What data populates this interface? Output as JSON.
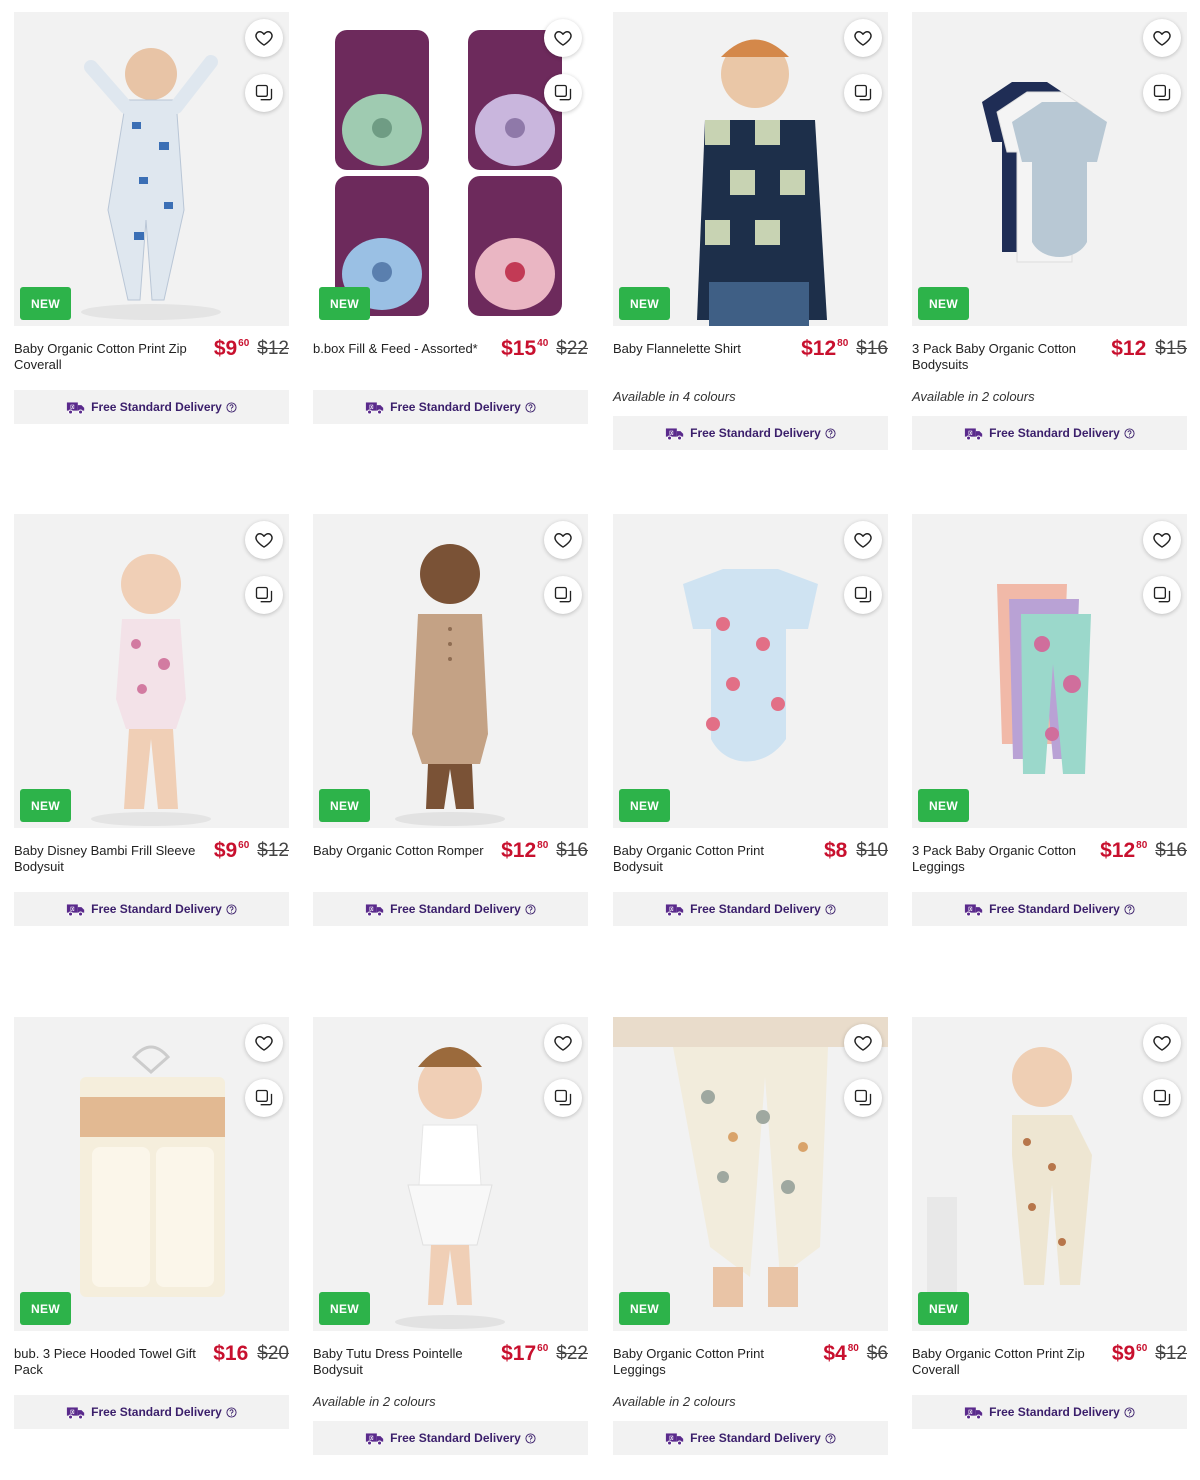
{
  "badge_new": "NEW",
  "delivery_label": "Free Standard Delivery",
  "rows": [
    [
      {
        "title": "Baby Organic Cotton Print Zip Coverall",
        "price_dollars": "$9",
        "price_cents": "60",
        "was": "$12",
        "colours": ""
      },
      {
        "title": "b.box Fill & Feed - Assorted*",
        "price_dollars": "$15",
        "price_cents": "40",
        "was": "$22",
        "colours": ""
      },
      {
        "title": "Baby Flannelette Shirt",
        "price_dollars": "$12",
        "price_cents": "80",
        "was": "$16",
        "colours": "Available in 4 colours"
      },
      {
        "title": "3 Pack Baby Organic Cotton Bodysuits",
        "price_dollars": "$12",
        "price_cents": "",
        "was": "$15",
        "colours": "Available in 2 colours"
      }
    ],
    [
      {
        "title": "Baby Disney Bambi Frill Sleeve Bodysuit",
        "price_dollars": "$9",
        "price_cents": "60",
        "was": "$12",
        "colours": ""
      },
      {
        "title": "Baby Organic Cotton Romper",
        "price_dollars": "$12",
        "price_cents": "80",
        "was": "$16",
        "colours": ""
      },
      {
        "title": "Baby Organic Cotton Print Bodysuit",
        "price_dollars": "$8",
        "price_cents": "",
        "was": "$10",
        "colours": ""
      },
      {
        "title": "3 Pack Baby Organic Cotton Leggings",
        "price_dollars": "$12",
        "price_cents": "80",
        "was": "$16",
        "colours": ""
      }
    ],
    [
      {
        "title": "bub. 3 Piece Hooded Towel Gift Pack",
        "price_dollars": "$16",
        "price_cents": "",
        "was": "$20",
        "colours": ""
      },
      {
        "title": "Baby Tutu Dress Pointelle Bodysuit",
        "price_dollars": "$17",
        "price_cents": "60",
        "was": "$22",
        "colours": "Available in 2 colours"
      },
      {
        "title": "Baby Organic Cotton Print Leggings",
        "price_dollars": "$4",
        "price_cents": "80",
        "was": "$6",
        "colours": "Available in 2 colours"
      },
      {
        "title": "Baby Organic Cotton Print Zip Coverall",
        "price_dollars": "$9",
        "price_cents": "60",
        "was": "$12",
        "colours": ""
      }
    ]
  ],
  "colors": {
    "sale_red": "#c8102e",
    "badge_green": "#2db34a",
    "delivery_purple": "#5a2a8c"
  },
  "icons": {
    "favourite": "heart-icon",
    "compare": "compare-icon",
    "delivery": "delivery-truck-icon",
    "help": "help-circle-icon"
  }
}
